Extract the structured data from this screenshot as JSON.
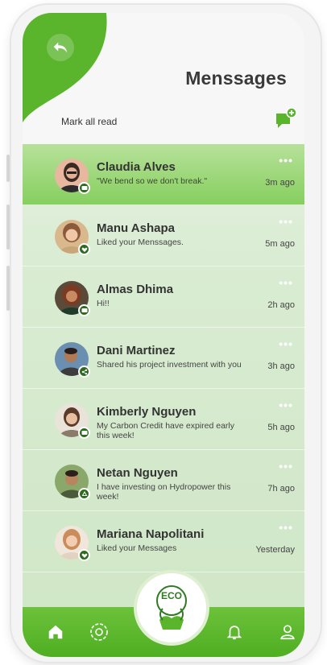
{
  "header": {
    "title": "Menssages",
    "mark_all_label": "Mark all read"
  },
  "colors": {
    "brand_green": "#5bb52c",
    "dark_green": "#2d6a1f",
    "active_row": "#8fd36a"
  },
  "messages": [
    {
      "name": "Claudia Alves",
      "preview": "\"We bend so we don't break.\"",
      "time": "3m ago",
      "badge_icon": "message-icon",
      "active": true
    },
    {
      "name": "Manu Ashapa",
      "preview": "Liked your Menssages.",
      "time": "5m ago",
      "badge_icon": "heart-icon",
      "active": false
    },
    {
      "name": "Almas Dhima",
      "preview": "Hi!!",
      "time": "2h ago",
      "badge_icon": "message-icon",
      "active": false
    },
    {
      "name": "Dani Martinez",
      "preview": "Shared his project investment with you",
      "time": "3h ago",
      "badge_icon": "share-icon",
      "active": false
    },
    {
      "name": "Kimberly Nguyen",
      "preview": "My Carbon Credit have expired early this week!",
      "time": "5h ago",
      "badge_icon": "message-icon",
      "active": false
    },
    {
      "name": "Netan Nguyen",
      "preview": "I have investing on Hydropower this week!",
      "time": "7h ago",
      "badge_icon": "recycle-icon",
      "active": false
    },
    {
      "name": "Mariana Napolitani",
      "preview": "Liked your  Messages",
      "time": "Yesterday",
      "badge_icon": "heart-icon",
      "active": false
    }
  ],
  "more_label": "•••",
  "tabbar": {
    "center_label": "ECO",
    "tabs": [
      "home-icon",
      "settings-icon",
      "bell-icon",
      "user-icon"
    ]
  }
}
